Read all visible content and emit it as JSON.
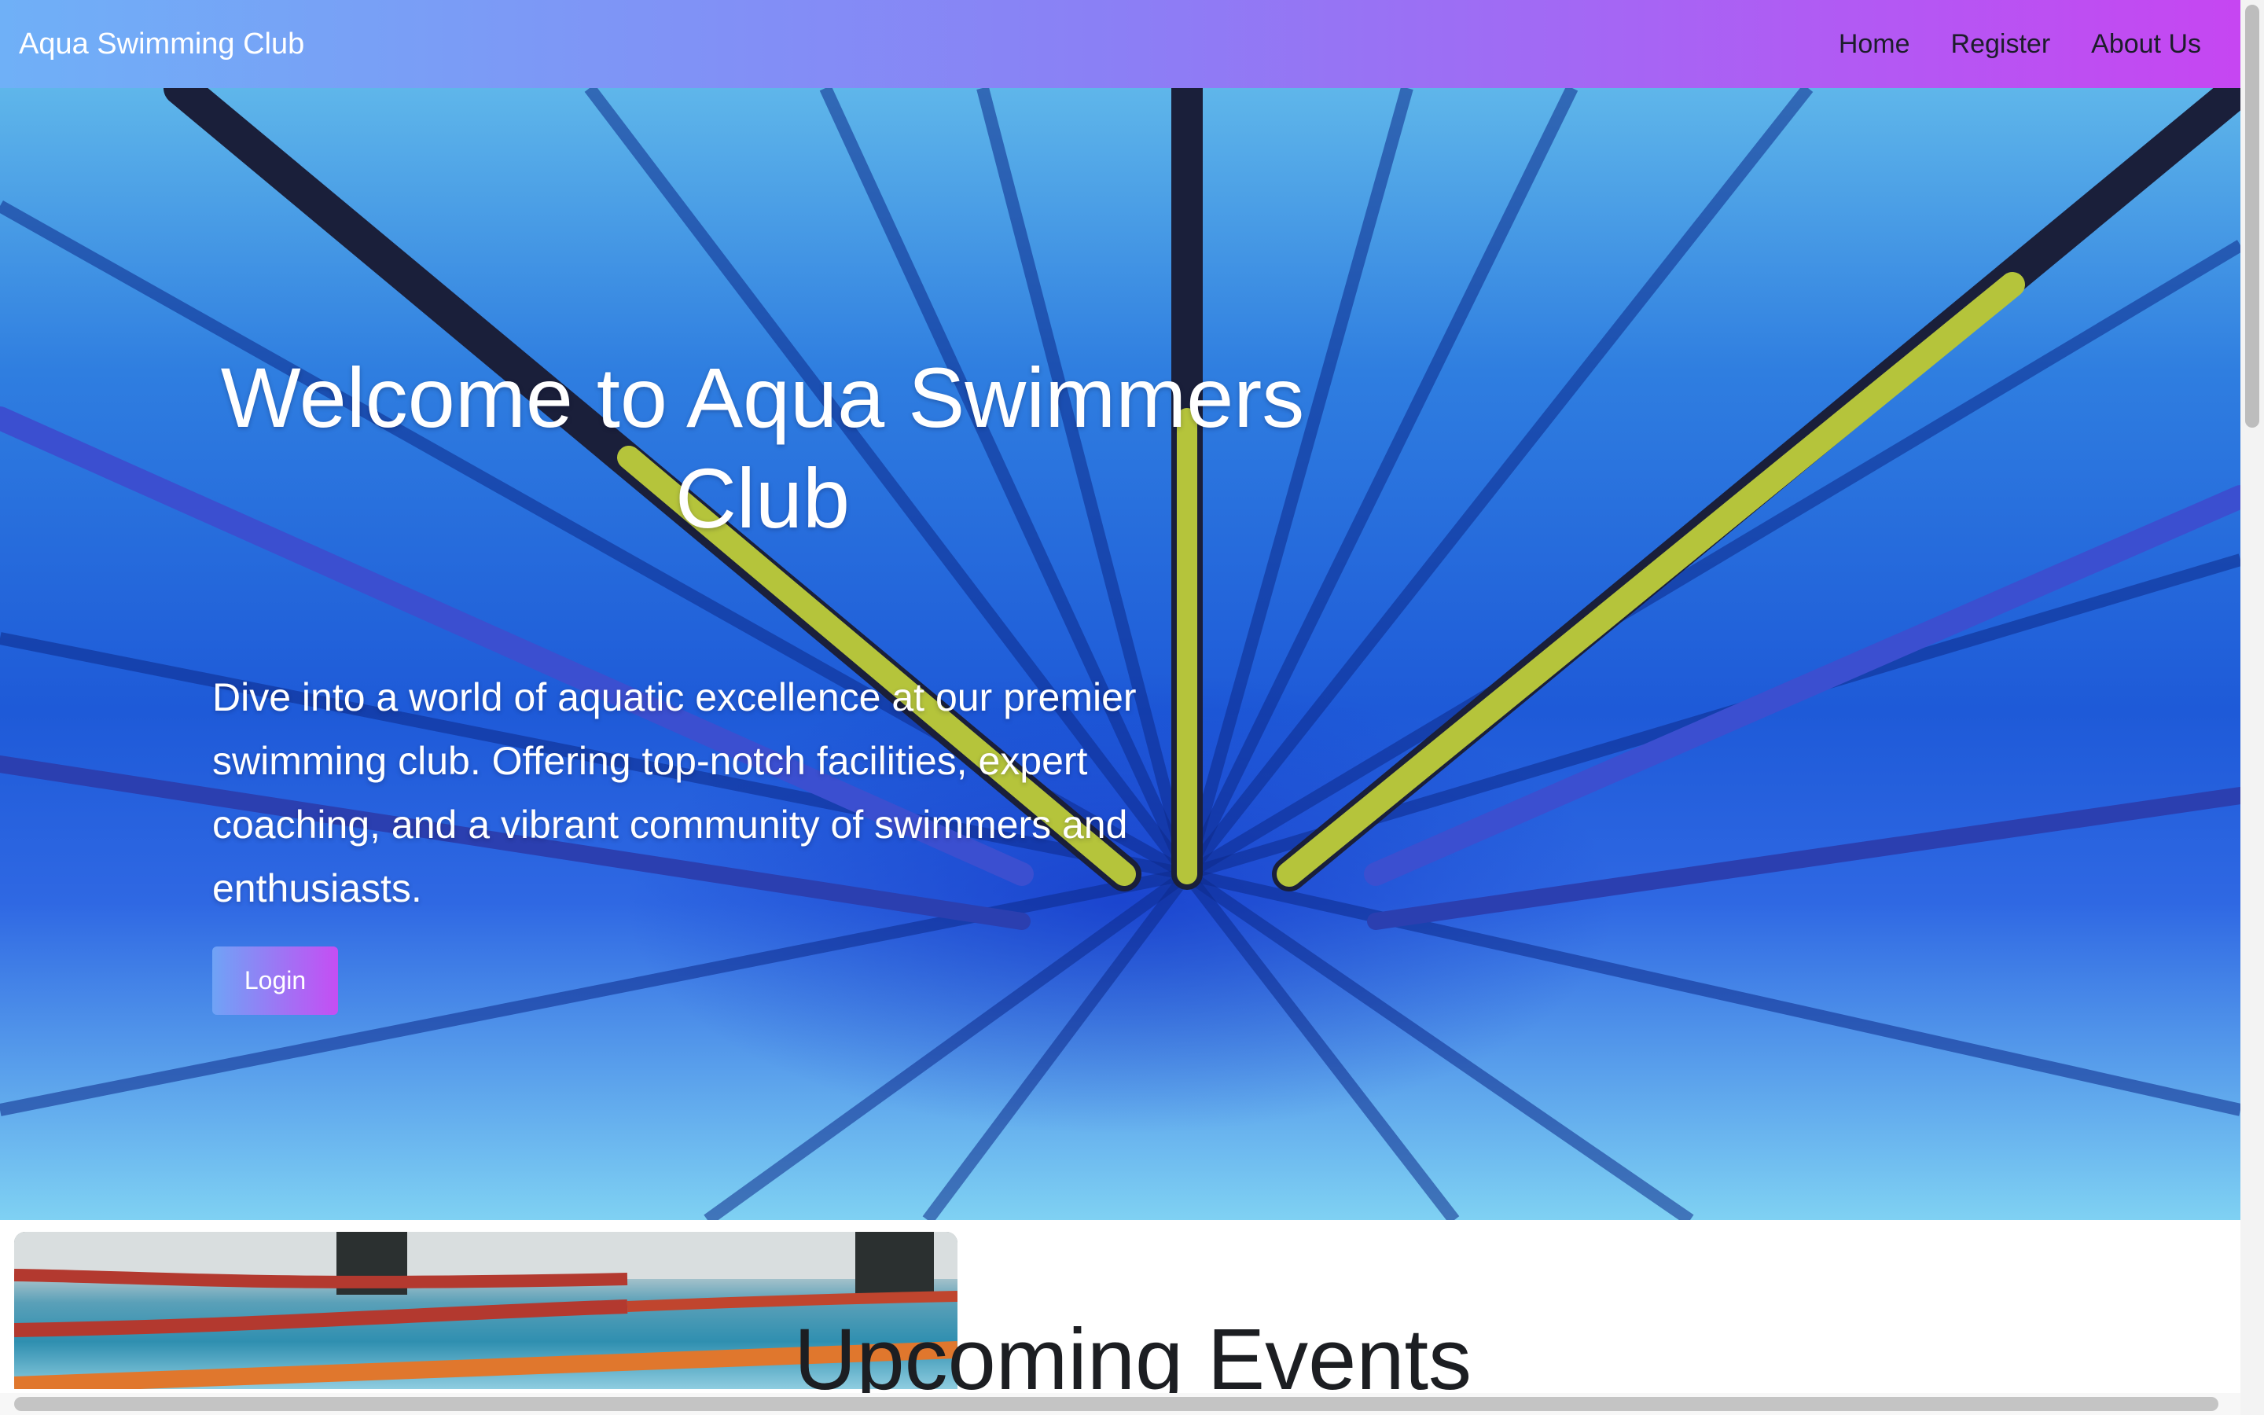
{
  "navbar": {
    "brand": "Aqua Swimming Club",
    "links": [
      "Home",
      "Register",
      "About Us"
    ],
    "gradient": [
      "#6fb0f7",
      "#c646f2"
    ]
  },
  "hero": {
    "title": "Welcome to Aqua Swimmers Club",
    "text": "Dive into a world of aquatic excellence at our premier swimming club. Offering top-notch facilities, expert coaching, and a vibrant community of swimmers and enthusiasts.",
    "login_label": "Login",
    "background_image": "underwater-pool-lanes"
  },
  "carousel": {
    "prev_icon": "chevron-left-icon"
  },
  "events": {
    "title": "Upcoming Events",
    "card_image": "pool-lane-ropes"
  }
}
